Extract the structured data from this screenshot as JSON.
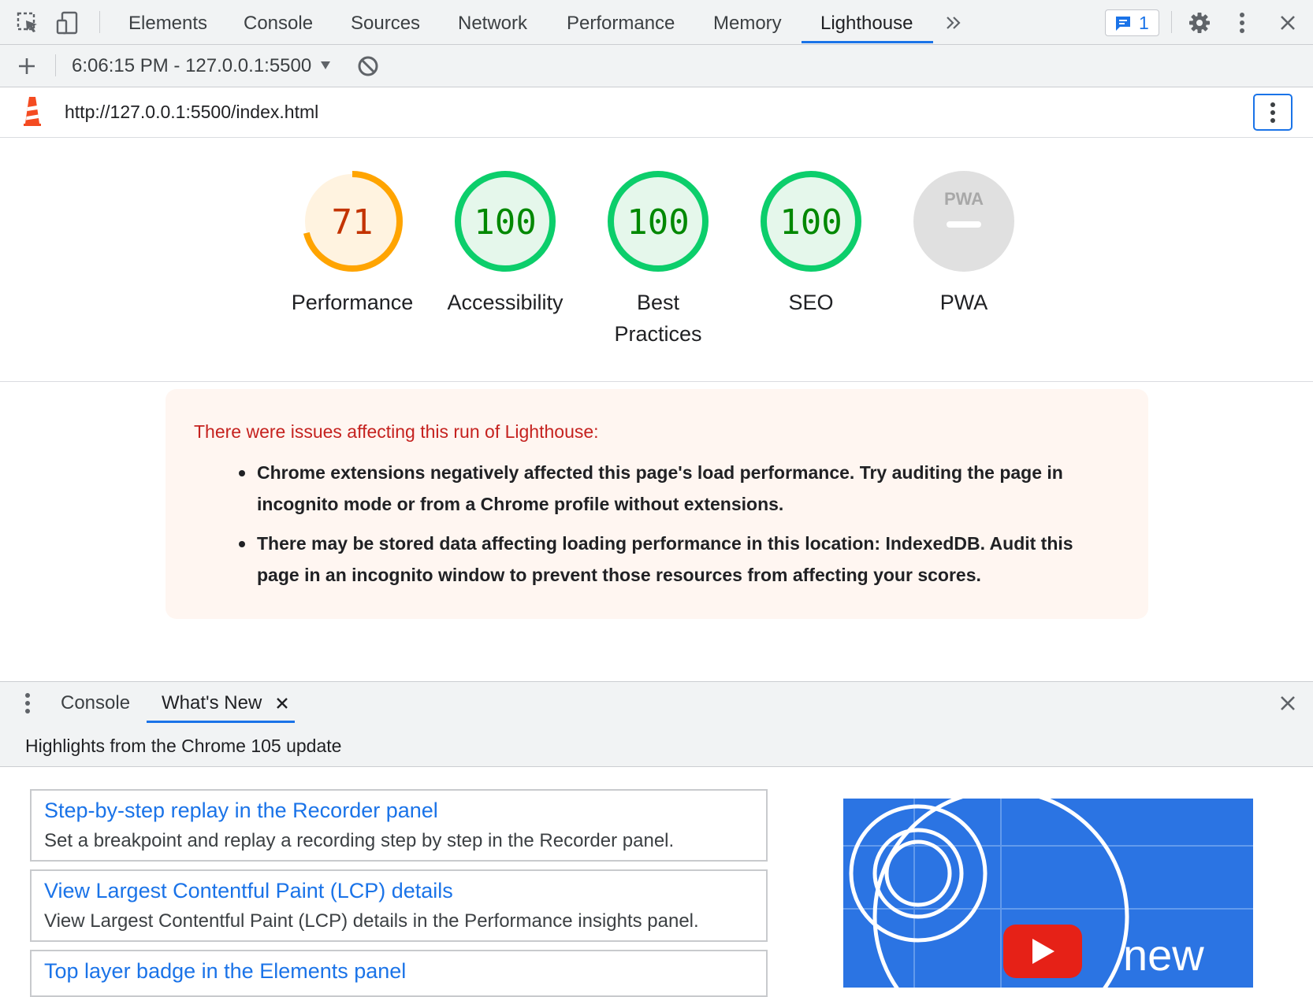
{
  "toolbar": {
    "tabs": [
      "Elements",
      "Console",
      "Sources",
      "Network",
      "Performance",
      "Memory",
      "Lighthouse"
    ],
    "active_tab": "Lighthouse",
    "issues_count": "1"
  },
  "report_bar": {
    "report_selector": "6:06:15 PM - 127.0.0.1:5500"
  },
  "url_bar": {
    "url": "http://127.0.0.1:5500/index.html"
  },
  "gauges": [
    {
      "label": "Performance",
      "score": "71",
      "value": 71,
      "color": "#ffa400",
      "text_color": "#c33300",
      "fill": "#fff3e0"
    },
    {
      "label": "Accessibility",
      "score": "100",
      "value": 100,
      "color": "#0cce6b",
      "text_color": "#008800",
      "fill": "#e5f7eb"
    },
    {
      "label_line1": "Best",
      "label_line2": "Practices",
      "score": "100",
      "value": 100,
      "color": "#0cce6b",
      "text_color": "#008800",
      "fill": "#e5f7eb"
    },
    {
      "label": "SEO",
      "score": "100",
      "value": 100,
      "color": "#0cce6b",
      "text_color": "#008800",
      "fill": "#e5f7eb"
    },
    {
      "label": "PWA",
      "badge_text": "PWA",
      "color": "#e0e0e0"
    }
  ],
  "warnings": {
    "title": "There were issues affecting this run of Lighthouse:",
    "items": [
      {
        "line1": "Chrome extensions negatively affected this page's load performance. Try auditing the page in",
        "line2": "incognito mode or from a Chrome profile without extensions."
      },
      {
        "line1": "There may be stored data affecting loading performance in this location: IndexedDB. Audit this",
        "line2": "page in an incognito window to prevent those resources from affecting your scores."
      }
    ]
  },
  "drawer": {
    "tabs": [
      "Console",
      "What's New"
    ],
    "active_tab": "What's New",
    "highlights_title": "Highlights from the Chrome 105 update",
    "cards": [
      {
        "title": "Step-by-step replay in the Recorder panel",
        "description": "Set a breakpoint and replay a recording step by step in the Recorder panel."
      },
      {
        "title": "View Largest Contentful Paint (LCP) details",
        "description": "View Largest Contentful Paint (LCP) details in the Performance insights panel."
      },
      {
        "title": "Top layer badge in the Elements panel"
      }
    ],
    "video_caption": "new"
  },
  "colors": {
    "accent": "#1a73e8",
    "warning_text": "#c5221f",
    "warning_bg": "#fff6f1",
    "lighthouse_logo": "#f44b21"
  }
}
